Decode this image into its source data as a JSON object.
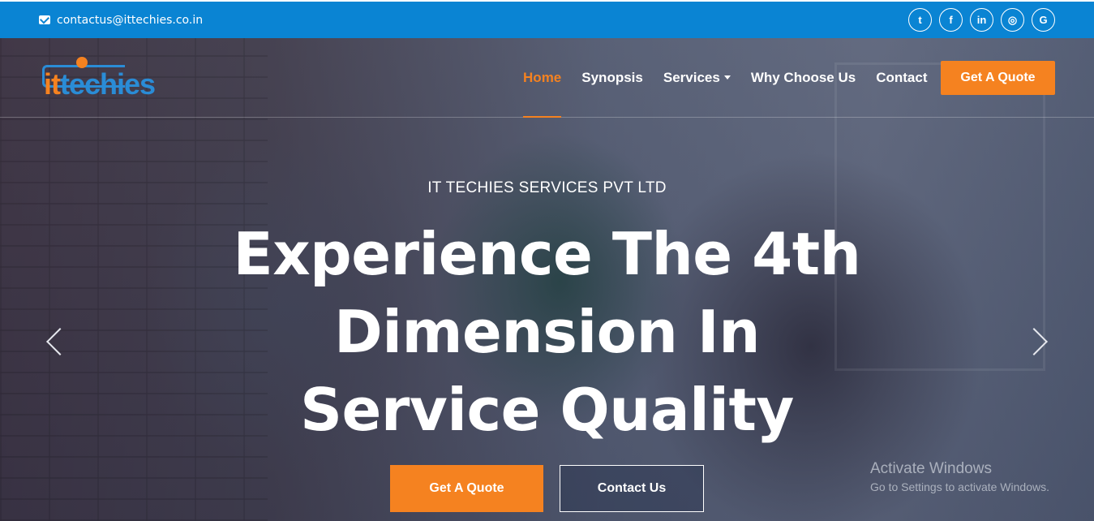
{
  "topbar": {
    "email": "contactus@ittechies.co.in",
    "email_icon": "envelope-icon",
    "socials": [
      {
        "name": "twitter-icon",
        "glyph": "t"
      },
      {
        "name": "facebook-icon",
        "glyph": "f"
      },
      {
        "name": "linkedin-icon",
        "glyph": "in"
      },
      {
        "name": "instagram-icon",
        "glyph": "◎"
      },
      {
        "name": "google-icon",
        "glyph": "G"
      }
    ]
  },
  "logo": {
    "it": "it",
    "rest": "techies"
  },
  "nav": {
    "items": [
      "Home",
      "Synopsis",
      "Services",
      "Why Choose Us",
      "Contact"
    ],
    "active": "Home",
    "quote_button": "Get A Quote"
  },
  "hero": {
    "company": "IT TECHIES SERVICES PVT LTD",
    "headline": "Experience The 4th Dimension In Service Quality",
    "primary_cta": "Get A Quote",
    "secondary_cta": "Contact Us"
  },
  "watermark": {
    "title": "Activate Windows",
    "subtitle": "Go to Settings to activate Windows."
  },
  "colors": {
    "accent": "#f58220",
    "topbar": "#0a84d3",
    "brand_blue": "#2a8cd6"
  }
}
